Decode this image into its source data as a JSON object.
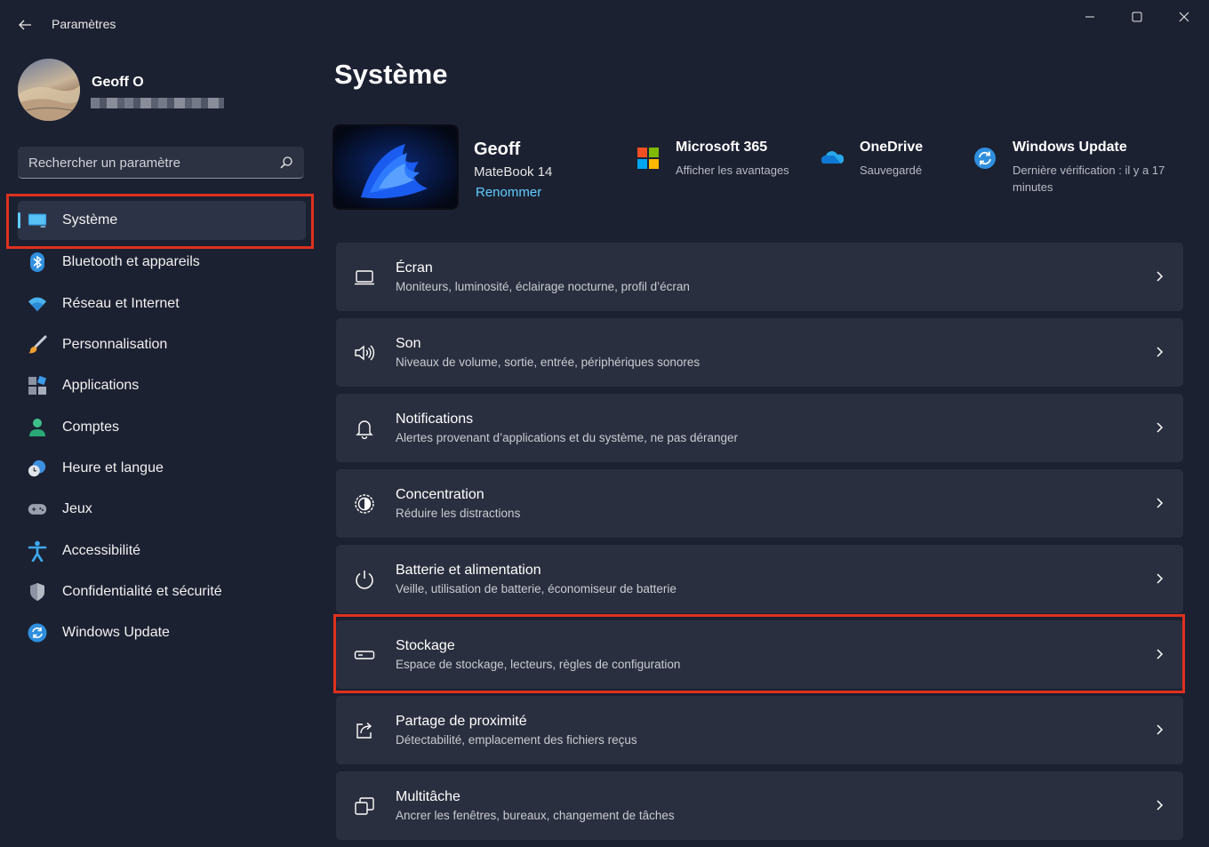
{
  "window": {
    "title": "Paramètres"
  },
  "profile": {
    "name": "Geoff O"
  },
  "search": {
    "placeholder": "Rechercher un paramètre"
  },
  "sidebar": {
    "items": [
      {
        "label": "Système",
        "icon": "system-icon",
        "active": true
      },
      {
        "label": "Bluetooth et appareils",
        "icon": "bluetooth-icon"
      },
      {
        "label": "Réseau et Internet",
        "icon": "wifi-icon"
      },
      {
        "label": "Personnalisation",
        "icon": "brush-icon"
      },
      {
        "label": "Applications",
        "icon": "apps-icon"
      },
      {
        "label": "Comptes",
        "icon": "account-icon"
      },
      {
        "label": "Heure et langue",
        "icon": "clock-globe-icon"
      },
      {
        "label": "Jeux",
        "icon": "gamepad-icon"
      },
      {
        "label": "Accessibilité",
        "icon": "accessibility-icon"
      },
      {
        "label": "Confidentialité et sécurité",
        "icon": "shield-icon"
      },
      {
        "label": "Windows Update",
        "icon": "update-icon"
      }
    ]
  },
  "main": {
    "title": "Système",
    "device": {
      "name": "Geoff",
      "model": "MateBook 14",
      "rename_label": "Renommer"
    },
    "status": [
      {
        "title": "Microsoft 365",
        "subtitle": "Afficher les avantages",
        "icon": "microsoft-logo-icon"
      },
      {
        "title": "OneDrive",
        "subtitle": "Sauvegardé",
        "icon": "onedrive-icon"
      },
      {
        "title": "Windows Update",
        "subtitle": "Dernière vérification : il y a 17 minutes",
        "icon": "update-icon"
      }
    ],
    "cards": [
      {
        "title": "Écran",
        "subtitle": "Moniteurs, luminosité, éclairage nocturne, profil d’écran",
        "icon": "display-icon"
      },
      {
        "title": "Son",
        "subtitle": "Niveaux de volume, sortie, entrée, périphériques sonores",
        "icon": "speaker-icon"
      },
      {
        "title": "Notifications",
        "subtitle": "Alertes provenant d’applications et du système, ne pas déranger",
        "icon": "bell-icon"
      },
      {
        "title": "Concentration",
        "subtitle": "Réduire les distractions",
        "icon": "focus-icon"
      },
      {
        "title": "Batterie et alimentation",
        "subtitle": "Veille, utilisation de batterie, économiseur de batterie",
        "icon": "power-icon"
      },
      {
        "title": "Stockage",
        "subtitle": "Espace de stockage, lecteurs, règles de configuration",
        "icon": "storage-icon"
      },
      {
        "title": "Partage de proximité",
        "subtitle": "Détectabilité, emplacement des fichiers reçus",
        "icon": "share-icon"
      },
      {
        "title": "Multitâche",
        "subtitle": "Ancrer les fenêtres, bureaux, changement de tâches",
        "icon": "multitask-icon"
      }
    ]
  },
  "colors": {
    "background": "#1c2132",
    "card": "#2a2f3f",
    "accent": "#60cdff",
    "highlight": "#e0301e"
  }
}
